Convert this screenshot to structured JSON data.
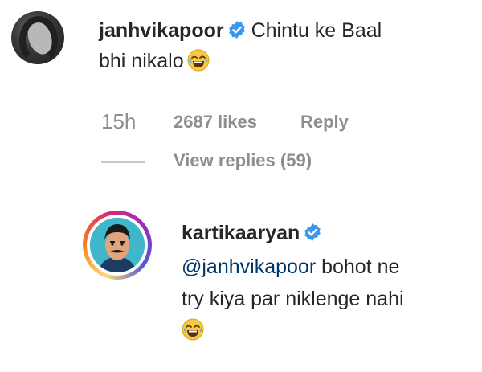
{
  "comments": [
    {
      "username": "janhvikapoor",
      "verified": true,
      "text_line1": "Chintu ke Baal",
      "text_line2": "bhi nikalo",
      "emoji": "face-with-tears-of-joy",
      "time": "15h",
      "likes": "2687 likes",
      "reply_label": "Reply",
      "view_replies": "View replies (59)"
    },
    {
      "username": "kartikaaryan",
      "verified": true,
      "mention": "@janhvikapoor",
      "text_line1_rest": " bohot ne",
      "text_line2": "try kiya par niklenge nahi",
      "emoji": "face-with-tears-of-joy"
    }
  ],
  "colors": {
    "text": "#262626",
    "meta": "#8e8e8e",
    "mention": "#00376b",
    "verified": "#3897f0"
  }
}
